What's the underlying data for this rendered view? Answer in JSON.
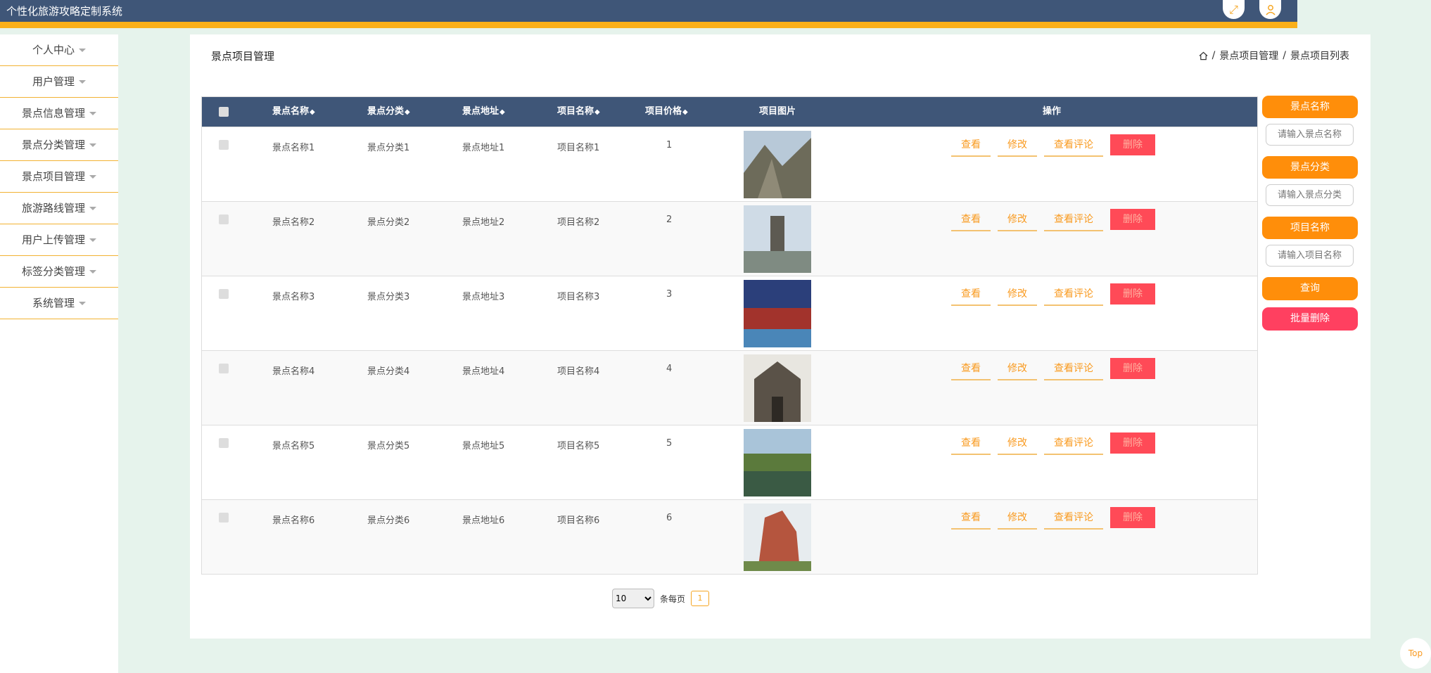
{
  "header": {
    "title": "个性化旅游攻略定制系统"
  },
  "sidebar": {
    "items": [
      {
        "label": "个人中心"
      },
      {
        "label": "用户管理"
      },
      {
        "label": "景点信息管理"
      },
      {
        "label": "景点分类管理"
      },
      {
        "label": "景点项目管理"
      },
      {
        "label": "旅游路线管理"
      },
      {
        "label": "用户上传管理"
      },
      {
        "label": "标签分类管理"
      },
      {
        "label": "系统管理"
      }
    ]
  },
  "main": {
    "page_title": "景点项目管理",
    "breadcrumb": {
      "level1": "景点项目管理",
      "level2": "景点项目列表",
      "separator": "/"
    }
  },
  "table": {
    "headers": {
      "name": "景点名称",
      "category": "景点分类",
      "address": "景点地址",
      "project": "项目名称",
      "price": "项目价格",
      "image": "项目图片",
      "ops": "操作"
    },
    "sort_glyph": "◆",
    "rows": [
      {
        "name": "景点名称1",
        "category": "景点分类1",
        "address": "景点地址1",
        "project": "项目名称1",
        "price": "1"
      },
      {
        "name": "景点名称2",
        "category": "景点分类2",
        "address": "景点地址2",
        "project": "项目名称2",
        "price": "2"
      },
      {
        "name": "景点名称3",
        "category": "景点分类3",
        "address": "景点地址3",
        "project": "项目名称3",
        "price": "3"
      },
      {
        "name": "景点名称4",
        "category": "景点分类4",
        "address": "景点地址4",
        "project": "项目名称4",
        "price": "4"
      },
      {
        "name": "景点名称5",
        "category": "景点分类5",
        "address": "景点地址5",
        "project": "项目名称5",
        "price": "5"
      },
      {
        "name": "景点名称6",
        "category": "景点分类6",
        "address": "景点地址6",
        "project": "项目名称6",
        "price": "6"
      }
    ],
    "ops": {
      "view": "查看",
      "edit": "修改",
      "comments": "查看评论",
      "delete": "删除"
    }
  },
  "search": {
    "name_label": "景点名称",
    "name_placeholder": "请输入景点名称",
    "category_label": "景点分类",
    "category_placeholder": "请输入景点分类",
    "project_label": "项目名称",
    "project_placeholder": "请输入项目名称",
    "query_button": "查询",
    "batch_delete_button": "批量删除"
  },
  "pager": {
    "page_size": "10",
    "per_page_label": "条每页",
    "current_page": "1"
  },
  "top_button": "Top",
  "colors": {
    "header": "#3f5678",
    "accent": "#fbb01a",
    "orange": "#ff8e0a",
    "danger": "#ff4a57"
  }
}
